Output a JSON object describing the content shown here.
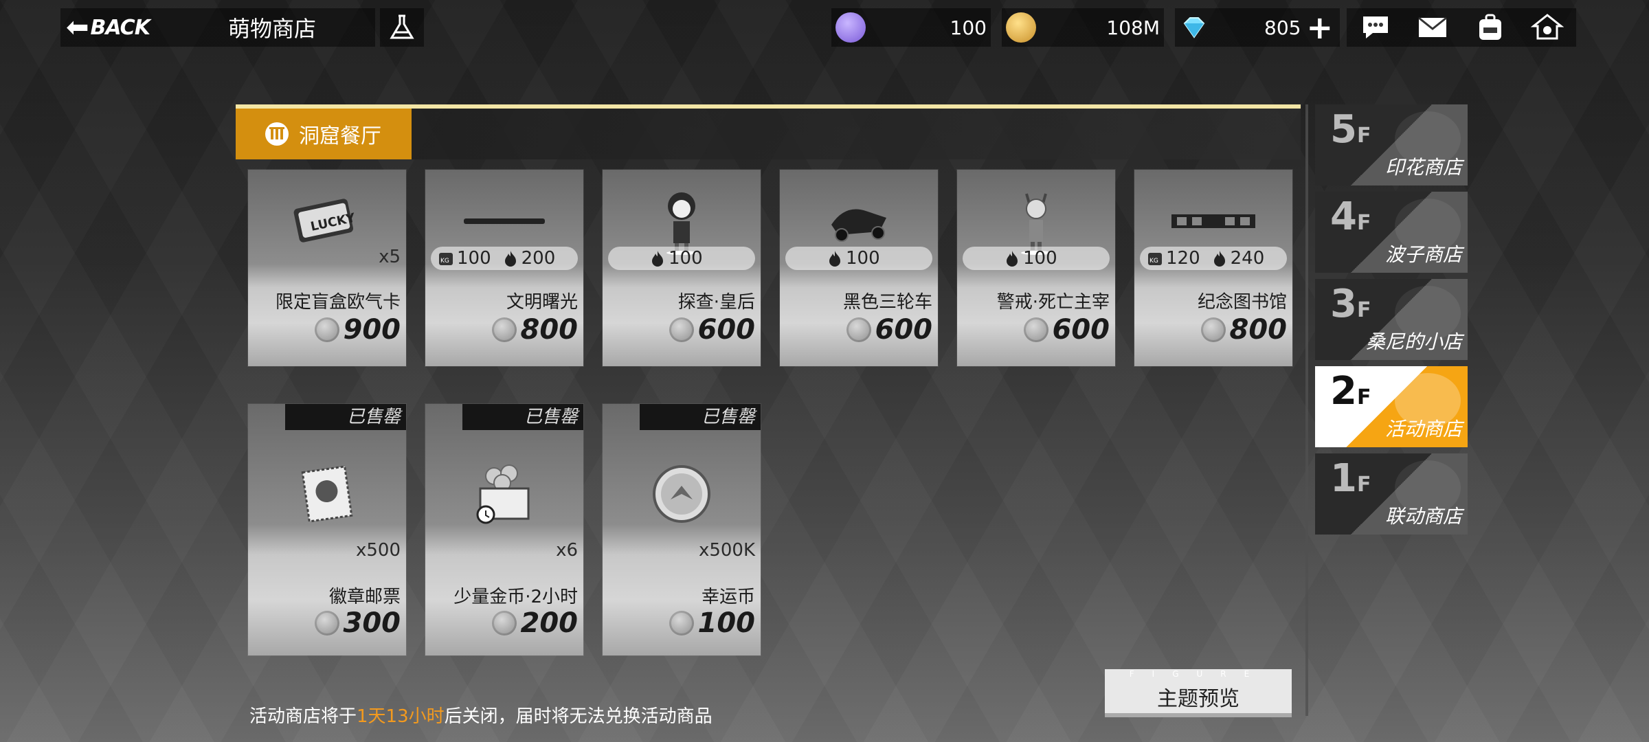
{
  "header": {
    "back_label": "BACK",
    "title": "萌物商店",
    "currencies": [
      {
        "name": "crystal-currency",
        "value": "100",
        "color": "#9b8cff"
      },
      {
        "name": "gold-coin",
        "value": "108M",
        "color": "#e0b04a"
      },
      {
        "name": "diamond",
        "value": "805",
        "color": "#7fe0ff"
      }
    ],
    "system_icons": [
      "chat-icon",
      "mail-icon",
      "backpack-icon",
      "home-icon"
    ]
  },
  "category": {
    "label": "洞窟餐厅",
    "accent_color": "#d48f0f"
  },
  "items": [
    {
      "name": "限定盲盒欧气卡",
      "qty": "x5",
      "price": "900",
      "stats": []
    },
    {
      "name": "文明曙光",
      "qty": "",
      "price": "800",
      "stats": [
        {
          "icon": "weight-icon",
          "value": "100"
        },
        {
          "icon": "flame-icon",
          "value": "200"
        }
      ]
    },
    {
      "name": "探查·皇后",
      "qty": "",
      "price": "600",
      "stats": [
        {
          "icon": "flame-icon",
          "value": "100"
        }
      ]
    },
    {
      "name": "黑色三轮车",
      "qty": "",
      "price": "600",
      "stats": [
        {
          "icon": "flame-icon",
          "value": "100"
        }
      ]
    },
    {
      "name": "警戒·死亡主宰",
      "qty": "",
      "price": "600",
      "stats": [
        {
          "icon": "flame-icon",
          "value": "100"
        }
      ]
    },
    {
      "name": "纪念图书馆",
      "qty": "",
      "price": "800",
      "stats": [
        {
          "icon": "weight-icon",
          "value": "120"
        },
        {
          "icon": "flame-icon",
          "value": "240"
        }
      ]
    },
    {
      "name": "徽章邮票",
      "qty": "x500",
      "price": "300",
      "sold": "已售罄"
    },
    {
      "name": "少量金币·2小时",
      "qty": "x6",
      "price": "200",
      "sold": "已售罄"
    },
    {
      "name": "幸运币",
      "qty": "x500K",
      "price": "100",
      "sold": "已售罄"
    }
  ],
  "floors": [
    {
      "num": "5",
      "suffix": "F",
      "name": "印花商店",
      "active": false
    },
    {
      "num": "4",
      "suffix": "F",
      "name": "波子商店",
      "active": false
    },
    {
      "num": "3",
      "suffix": "F",
      "name": "桑尼的小店",
      "active": false
    },
    {
      "num": "2",
      "suffix": "F",
      "name": "活动商店",
      "active": true
    },
    {
      "num": "1",
      "suffix": "F",
      "name": "联动商店",
      "active": false
    }
  ],
  "footer": {
    "notice_pre": "活动商店将于",
    "notice_time": "1天13小时",
    "notice_post": "后关闭，届时将无法兑换活动商品",
    "preview_caption": "FIGURE",
    "preview_label": "主题预览"
  }
}
